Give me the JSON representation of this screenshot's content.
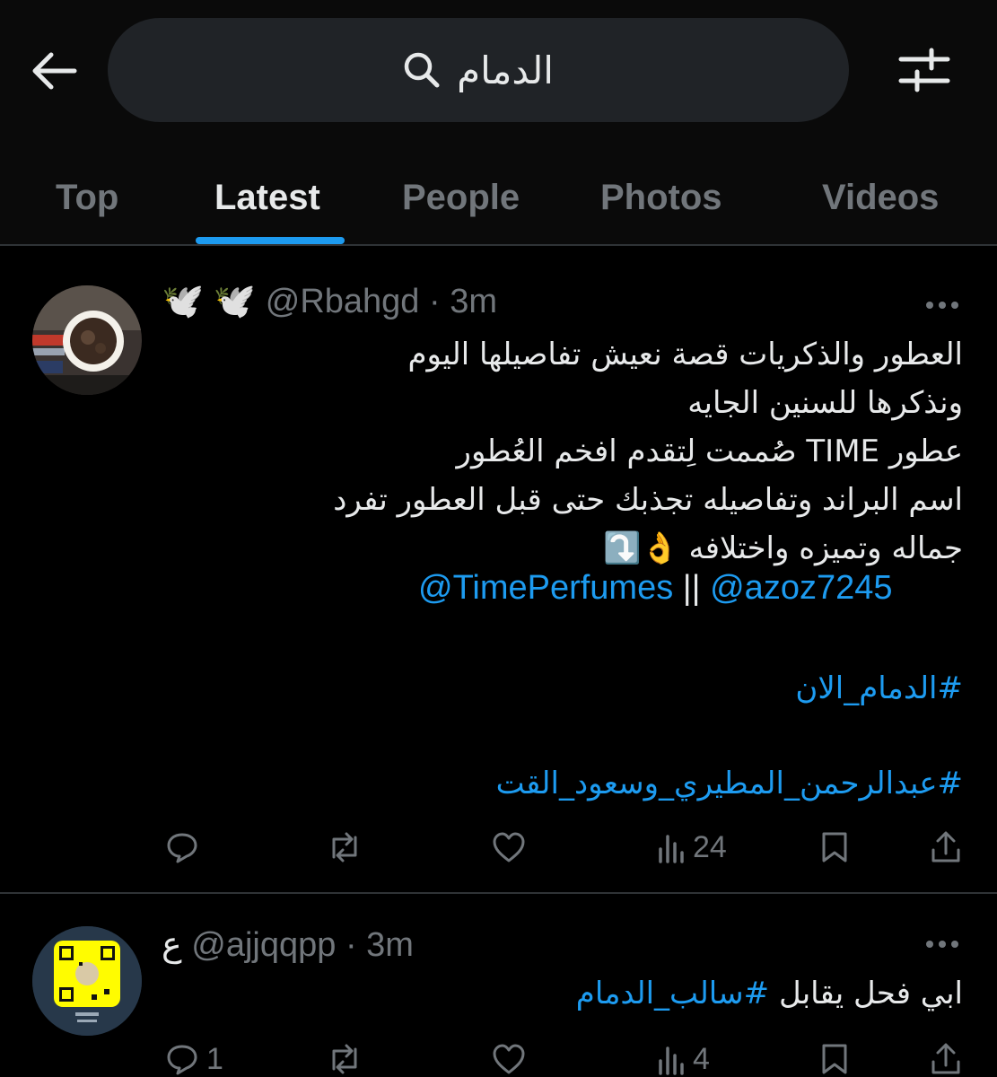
{
  "search": {
    "query": "الدمام"
  },
  "tabs": [
    {
      "label": "Top"
    },
    {
      "label": "Latest"
    },
    {
      "label": "People"
    },
    {
      "label": "Photos"
    },
    {
      "label": "Videos"
    }
  ],
  "active_tab": "Latest",
  "colors": {
    "accent": "#1d9bf0",
    "muted": "#71767b",
    "text": "#e7e9ea",
    "background": "#000000",
    "search_bg": "#202327"
  },
  "tweets": [
    {
      "display_name": "🕊️ 🕊️",
      "handle": "@Rbahgd",
      "time": "3m",
      "lines": [
        "العطور والذكريات قصة نعيش تفاصيلها اليوم",
        "ونذكرها للسنين الجايه",
        "عطور TIME صُممت لِتقدم افخم العُطور",
        "اسم البراند وتفاصيله تجذبك حتى قبل العطور  تفرد",
        "جماله وتميزه واختلافه 👌⤵️"
      ],
      "mention_1": "@TimePerfumes",
      "mention_sep": "||",
      "mention_2": "@azoz7245",
      "hashtag_1": "#الدمام_الان",
      "hashtag_2": "#عبدالرحمن_المطيري_وسعود_القت",
      "replies": "",
      "retweets": "",
      "likes": "",
      "views": "24"
    },
    {
      "display_name": "ع",
      "handle": "@ajjqqpp",
      "time": "3m",
      "text": "ابي فحل يقابل",
      "hashtag": "#سالب_الدمام",
      "replies": "1",
      "retweets": "",
      "likes": "",
      "views": "4"
    }
  ],
  "icons": [
    "back-arrow-icon",
    "search-icon",
    "filter-icon",
    "more-icon",
    "reply-icon",
    "retweet-icon",
    "like-icon",
    "views-icon",
    "bookmark-icon",
    "share-icon"
  ]
}
